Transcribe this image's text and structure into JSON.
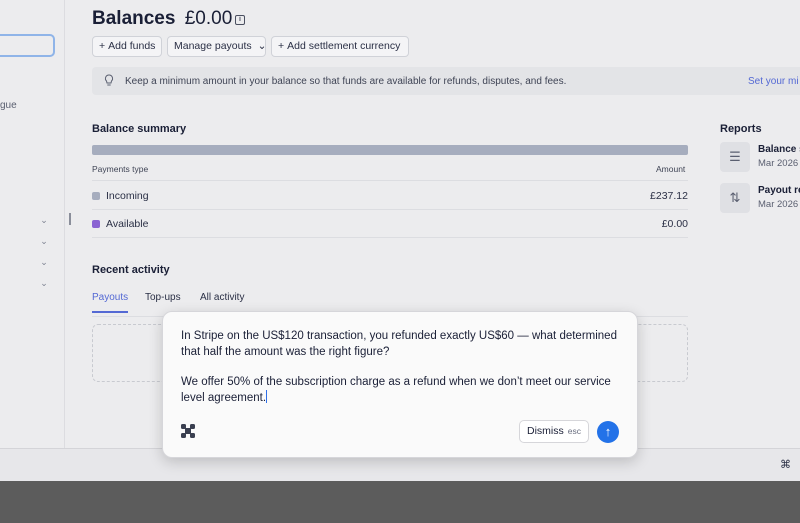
{
  "page": {
    "title": "Balances",
    "balance": "£0.00",
    "actions": {
      "add_funds": "Add funds",
      "manage_payouts": "Manage payouts",
      "add_currency": "Add settlement currency"
    },
    "notice": {
      "text": "Keep a minimum amount in your balance so that funds are available for refunds, disputes, and fees.",
      "link": "Set your mi"
    }
  },
  "sidebar": {
    "partial_text": "gue"
  },
  "balance_summary": {
    "title": "Balance summary",
    "col_type": "Payments type",
    "col_amount": "Amount",
    "rows": [
      {
        "label": "Incoming",
        "value": "£237.12",
        "color": "#a6adbe"
      },
      {
        "label": "Available",
        "value": "£0.00",
        "color": "#8a63d2"
      }
    ]
  },
  "recent_activity": {
    "title": "Recent activity",
    "tabs": [
      "Payouts",
      "Top-ups",
      "All activity"
    ],
    "active_tab": "Payouts"
  },
  "reports": {
    "title": "Reports",
    "items": [
      {
        "name": "Balance s",
        "date": "Mar 2026",
        "icon": "list-filter-icon"
      },
      {
        "name": "Payout re",
        "date": "Mar 2026",
        "icon": "arrows-updown-icon"
      }
    ]
  },
  "popup": {
    "question": "In Stripe on the US$120 transaction, you refunded exactly US$60 — what determined that half the amount was the right figure?",
    "answer": "We offer 50% of the subscription charge as a refund when we don’t meet our service level agreement.",
    "dismiss": "Dismiss",
    "dismiss_key": "esc",
    "send_icon": "arrow-up-icon",
    "accent": "#2372e8"
  }
}
